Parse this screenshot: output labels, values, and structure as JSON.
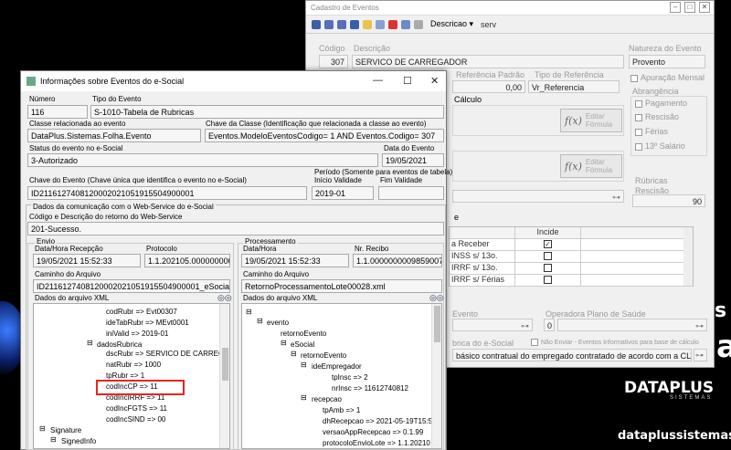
{
  "background": {
    "caption_right": "s",
    "caption_right2": "a",
    "brand": "DATAPLUS",
    "brand_sub": "SISTEMAS",
    "site": "dataplussistemas.com"
  },
  "back_window": {
    "title": "Cadastro de Eventos",
    "toolbar": {
      "descricao": "Descricao",
      "serv": "serv"
    },
    "codigo_label": "Código",
    "codigo": "307",
    "descricao_label": "Descrição",
    "descricao": "SERVICO DE CARREGADOR",
    "natureza_label": "Natureza do Evento",
    "natureza": "Provento",
    "ref_padrao_label": "Referência Padrão",
    "ref_padrao": "0,00",
    "tipo_ref_label": "Tipo de Referência",
    "tipo_ref": "Vr_Referencia",
    "apuracao_mensal": "Apuração Mensal",
    "calculo_label": "Cálculo",
    "editar_formula": "Editar Fórmula",
    "abrangencia_label": "Abrangência",
    "abrangencia": [
      "Pagamento",
      "Rescisão",
      "Férias",
      "13º Salário"
    ],
    "rubricas_rescisao_label": "Rúbricas Rescisão",
    "rubricas_rescisao": "90",
    "grid": {
      "header": "Incide",
      "rows": [
        {
          "label": "a Receber",
          "checked": true
        },
        {
          "label": "INSS s/ 13o.",
          "checked": false
        },
        {
          "label": "IRRF s/ 13o.",
          "checked": false
        },
        {
          "label": "IRRF s/ Férias",
          "checked": false
        }
      ]
    },
    "evento_label": "Evento",
    "plano_saude_label": "Operadora Plano de Saúde",
    "plano_saude": "0",
    "esocial_label": "brica do e-Social",
    "nao_enviar": "Não Enviar - Eventos Informativos para base de cálculo",
    "esocial_value": "básico contratual do empregado contratado de acordo com a CLT"
  },
  "front_window": {
    "title": "Informações sobre Eventos do e-Social",
    "numero_label": "Número",
    "numero": "116",
    "tipo_evento_label": "Tipo do Evento",
    "tipo_evento": "S-1010-Tabela de Rubricas",
    "classe_label": "Classe relacionada ao evento",
    "classe": "DataPlus.Sistemas.Folha.Evento",
    "chave_classe_label": "Chave da Classe (Identificação que relacionada a classe ao evento)",
    "chave_classe": "Eventos.ModeloEventosCodigo= 1  AND Eventos.Codigo= 307",
    "status_label": "Status do evento no e-Social",
    "status": "3-Autorizado",
    "data_evento_label": "Data do Evento",
    "data_evento": "19/05/2021",
    "chave_evento_label": "Chave do Evento (Chave única que identifica o evento no e-Social)",
    "chave_evento": "ID2116127408120002021051915504900001",
    "periodo_label": "Período (Somente para eventos de tabela)",
    "inicio_label": "Início Validade",
    "inicio": "2019-01",
    "fim_label": "Fim Validade",
    "fim": "",
    "dados_com_label": "Dados da comunicação com o Web-Service do e-Social",
    "codigo_retorno_label": "Código e Descrição do retorno do Web-Service",
    "codigo_retorno": "201-Sucesso.",
    "envio": {
      "label": "Envio",
      "data_label": "Data/Hora Recepção",
      "data": "19/05/2021 15:52:33",
      "protocolo_label": "Protocolo",
      "protocolo": "1.1.202105.0000000001",
      "caminho_label": "Caminho do Arquivo",
      "caminho": "ID2116127408120002021051915504900001_eSocial_e",
      "xml_label": "Dados do arquivo XML",
      "tree": [
        "codRubr => Evt00307",
        "ideTabRubr => MEvt0001",
        "iniValid => 2019-01",
        "dadosRubrica",
        "dscRubr => SERVICO DE CARREGAD",
        "natRubr => 1000",
        "tpRubr => 1",
        "codIncCP => 11",
        "codIncIRRF => 11",
        "codIncFGTS => 11",
        "codIncSIND => 00",
        "Signature",
        "SignedInfo"
      ]
    },
    "processamento": {
      "label": "Processamento",
      "data_label": "Data/Hora",
      "data": "19/05/2021 15:52:33",
      "recibo_label": "Nr. Recibo",
      "recibo": "1.1.0000000009859007",
      "caminho_label": "Caminho do Arquivo",
      "caminho": "RetornoProcessamentoLote00028.xml",
      "xml_label": "Dados do arquivo XML",
      "tree": [
        "evento",
        "retornoEvento",
        "eSocial",
        "retornoEvento",
        "ideEmpregador",
        "tpInsc => 2",
        "nrInsc => 11612740812",
        "recepcao",
        "tpAmb => 1",
        "dhRecepcao => 2021-05-19T15:52",
        "versaoAppRecepcao => 0.1.99",
        "protocoloEnvioLote => 1.1.20210"
      ]
    }
  },
  "colors": {
    "highlight": "#e22222"
  }
}
